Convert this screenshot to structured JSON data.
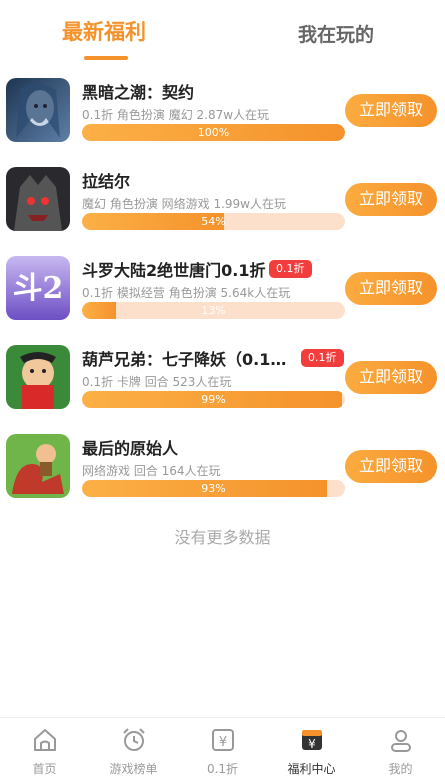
{
  "tabs": {
    "active": "最新福利",
    "inactive": "我在玩的"
  },
  "games": [
    {
      "name": "黑暗之潮：契约",
      "badge": "",
      "meta": "0.1折 角色扮演 魔幻 2.87w人在玩",
      "progress_label": "100%",
      "progress": 1.0,
      "button": "立即领取"
    },
    {
      "name": "拉结尔",
      "badge": "",
      "meta": "魔幻 角色扮演 网络游戏 1.99w人在玩",
      "progress_label": "54%",
      "progress": 0.54,
      "button": "立即领取"
    },
    {
      "name": "斗罗大陆2绝世唐门0.1折",
      "badge": "0.1折",
      "meta": "0.1折 模拟经营 角色扮演 5.64k人在玩",
      "progress_label": "13%",
      "progress": 0.13,
      "button": "立即领取"
    },
    {
      "name": "葫芦兄弟：七子降妖（0.1…",
      "badge": "0.1折",
      "meta": "0.1折 卡牌 回合 523人在玩",
      "progress_label": "99%",
      "progress": 0.99,
      "button": "立即领取"
    },
    {
      "name": "最后的原始人",
      "badge": "",
      "meta": "网络游戏 回合 164人在玩",
      "progress_label": "93%",
      "progress": 0.93,
      "button": "立即领取"
    }
  ],
  "no_more": "没有更多数据",
  "nav": [
    {
      "label": "首页",
      "icon": "home-icon"
    },
    {
      "label": "游戏榜单",
      "icon": "alarm-clock-icon"
    },
    {
      "label": "0.1折",
      "icon": "discount-icon"
    },
    {
      "label": "福利中心",
      "icon": "welfare-icon"
    },
    {
      "label": "我的",
      "icon": "user-icon"
    }
  ],
  "colors": {
    "accent": "#f5922b",
    "badge": "#f23d3d",
    "bar_bg": "#fde0cb"
  }
}
